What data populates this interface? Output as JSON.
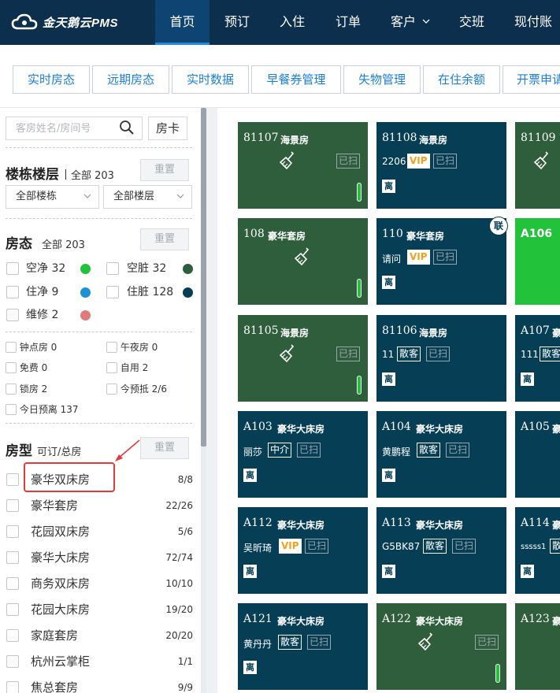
{
  "app": {
    "logo_text": "金天鹅云PMS"
  },
  "nav": [
    {
      "label": "首页",
      "active": true
    },
    {
      "label": "预订"
    },
    {
      "label": "入住"
    },
    {
      "label": "订单"
    },
    {
      "label": "客户"
    },
    {
      "label": "交班"
    },
    {
      "label": "现付账"
    }
  ],
  "tabs": [
    "实时房态",
    "远期房态",
    "实时数据",
    "早餐券管理",
    "失物管理",
    "在住余额",
    "开票申请"
  ],
  "sidebar": {
    "search_placeholder": "客房姓名/房间号",
    "room_card_label": "房卡",
    "building": {
      "title": "楼栋楼层",
      "summary": "全部 203",
      "reset": "重置",
      "building_select": "全部楼栋",
      "floor_select": "全部楼层"
    },
    "status": {
      "title": "房态",
      "summary": "全部 203",
      "reset": "重置",
      "items": [
        {
          "label": "空净 32",
          "color": "#22c23b"
        },
        {
          "label": "空脏 32",
          "color": "#2e5e3c"
        },
        {
          "label": "住净 9",
          "color": "#1e90d6"
        },
        {
          "label": "住脏 128",
          "color": "#063f55"
        },
        {
          "label": "维修 2",
          "color": "#e07b7b"
        }
      ]
    },
    "flags": [
      "钟点房 0",
      "午夜房 0",
      "免费 0",
      "自用 2",
      "锁房 2",
      "今预抵 2/6",
      "今日预离 137"
    ],
    "room_types": {
      "title": "房型",
      "summary": "可订/总房",
      "reset": "重置",
      "items": [
        {
          "name": "豪华双床房",
          "count": "8/8"
        },
        {
          "name": "豪华套房",
          "count": "22/26"
        },
        {
          "name": "花园双床房",
          "count": "5/6"
        },
        {
          "name": "豪华大床房",
          "count": "72/74"
        },
        {
          "name": "商务双床房",
          "count": "10/10"
        },
        {
          "name": "花园大床房",
          "count": "19/20"
        },
        {
          "name": "家庭套房",
          "count": "20/20"
        },
        {
          "name": "杭州云掌柜",
          "count": "1/1"
        },
        {
          "name": "焦总套房",
          "count": "9/9"
        }
      ]
    }
  },
  "rooms": [
    {
      "no": "81107",
      "type": "海景房",
      "status": "empty_dirty",
      "clean_tag": "已扫"
    },
    {
      "no": "81108",
      "type": "海景房",
      "status": "occupied",
      "guest": "2206",
      "badge": "VIP",
      "clean_tag": "已扫",
      "checkout": "离"
    },
    {
      "no": "81109",
      "type": "",
      "status": "empty_dirty"
    },
    {
      "no": "108",
      "type": "豪华套房",
      "status": "empty_dirty"
    },
    {
      "no": "110",
      "type": "豪华套房",
      "status": "occupied",
      "guest": "请问",
      "badge": "VIP",
      "clean_tag": "已扫",
      "checkout": "离",
      "linked": "联"
    },
    {
      "no": "A106",
      "type": "",
      "status": "empty_clean"
    },
    {
      "no": "81105",
      "type": "海景房",
      "status": "empty_dirty",
      "clean_tag": "已扫"
    },
    {
      "no": "81106",
      "type": "海景房",
      "status": "occupied",
      "guest": "11",
      "badge": "散客",
      "clean_tag": "已扫",
      "checkout": "离"
    },
    {
      "no": "A107",
      "type": "豪",
      "status": "occupied",
      "guest": "111",
      "badge": "散客",
      "checkout": "离"
    },
    {
      "no": "A103",
      "type": "豪华大床房",
      "status": "occupied",
      "guest": "丽莎",
      "badge": "中介",
      "clean_tag": "已扫",
      "checkout": "离"
    },
    {
      "no": "A104",
      "type": "豪华大床房",
      "status": "occupied",
      "guest": "黄鹏程",
      "badge": "散客",
      "clean_tag": "已扫",
      "checkout": "离"
    },
    {
      "no": "A105",
      "type": "豪",
      "status": "occupied"
    },
    {
      "no": "A112",
      "type": "豪华大床房",
      "status": "occupied",
      "guest": "吴昕琦",
      "badge": "VIP",
      "clean_tag": "已扫",
      "checkout": "离"
    },
    {
      "no": "A113",
      "type": "豪华大床房",
      "status": "occupied",
      "guest": "G5BK87",
      "badge": "散客",
      "clean_tag": "已扫",
      "checkout": "离"
    },
    {
      "no": "A114",
      "type": "豪",
      "status": "occupied",
      "guest": "sssss1",
      "badge": "散",
      "checkout": "离"
    },
    {
      "no": "A121",
      "type": "豪华大床房",
      "status": "occupied",
      "guest": "黄丹丹",
      "badge": "散客",
      "clean_tag": "已扫",
      "checkout": "离"
    },
    {
      "no": "A122",
      "type": "豪华大床房",
      "status": "empty_dirty",
      "clean_tag": "已扫"
    },
    {
      "no": "A123",
      "type": "豪",
      "status": "occupied"
    }
  ]
}
